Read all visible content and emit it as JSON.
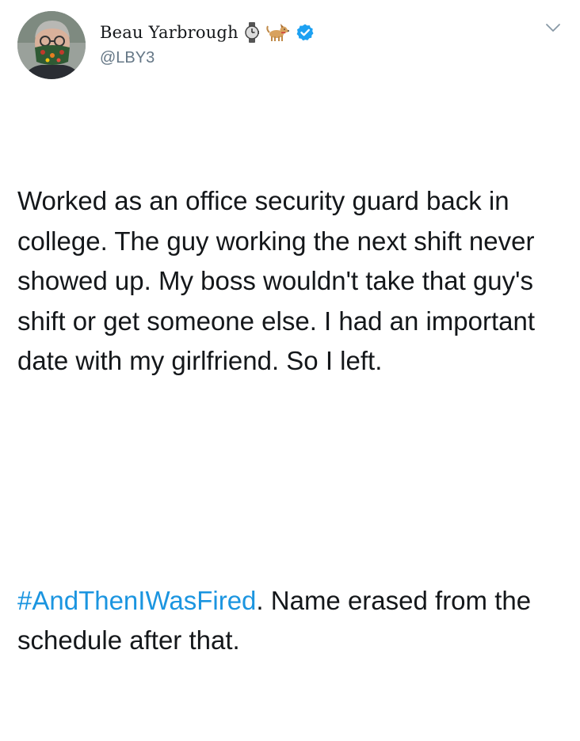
{
  "tweet": {
    "author": {
      "display_name": "Beau Yarbrough",
      "handle": "@LBY3",
      "name_emoji": [
        "watch-emoji",
        "dog-emoji"
      ],
      "verified": true
    },
    "paragraph1": "Worked as an office security guard back in college. The guy working the next shift never showed up. My boss wouldn't take that guy's shift or get someone else. I had an important date with my girlfriend. So I left.",
    "hashtag": "#AndThenIWasFired",
    "paragraph2_rest": ". Name erased from the schedule after that."
  },
  "colors": {
    "text": "#14171a",
    "secondary": "#657786",
    "link": "#1b95e0",
    "verified_badge": "#1da1f2"
  },
  "icons": {
    "menu": "chevron-down-icon",
    "badge": "verified-badge-icon"
  }
}
